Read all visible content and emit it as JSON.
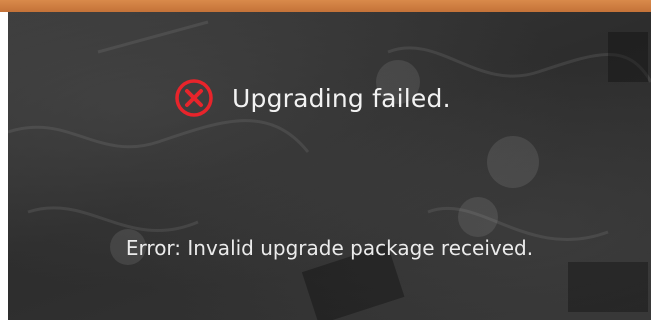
{
  "dialog": {
    "title": "Upgrading failed.",
    "status_icon": "error-x-circle-icon",
    "error_message": "Error: Invalid upgrade package received."
  },
  "colors": {
    "top_bar": "#c97a3f",
    "panel_background": "#303030",
    "error_icon": "#e8242b",
    "text": "#f2f2f2"
  }
}
